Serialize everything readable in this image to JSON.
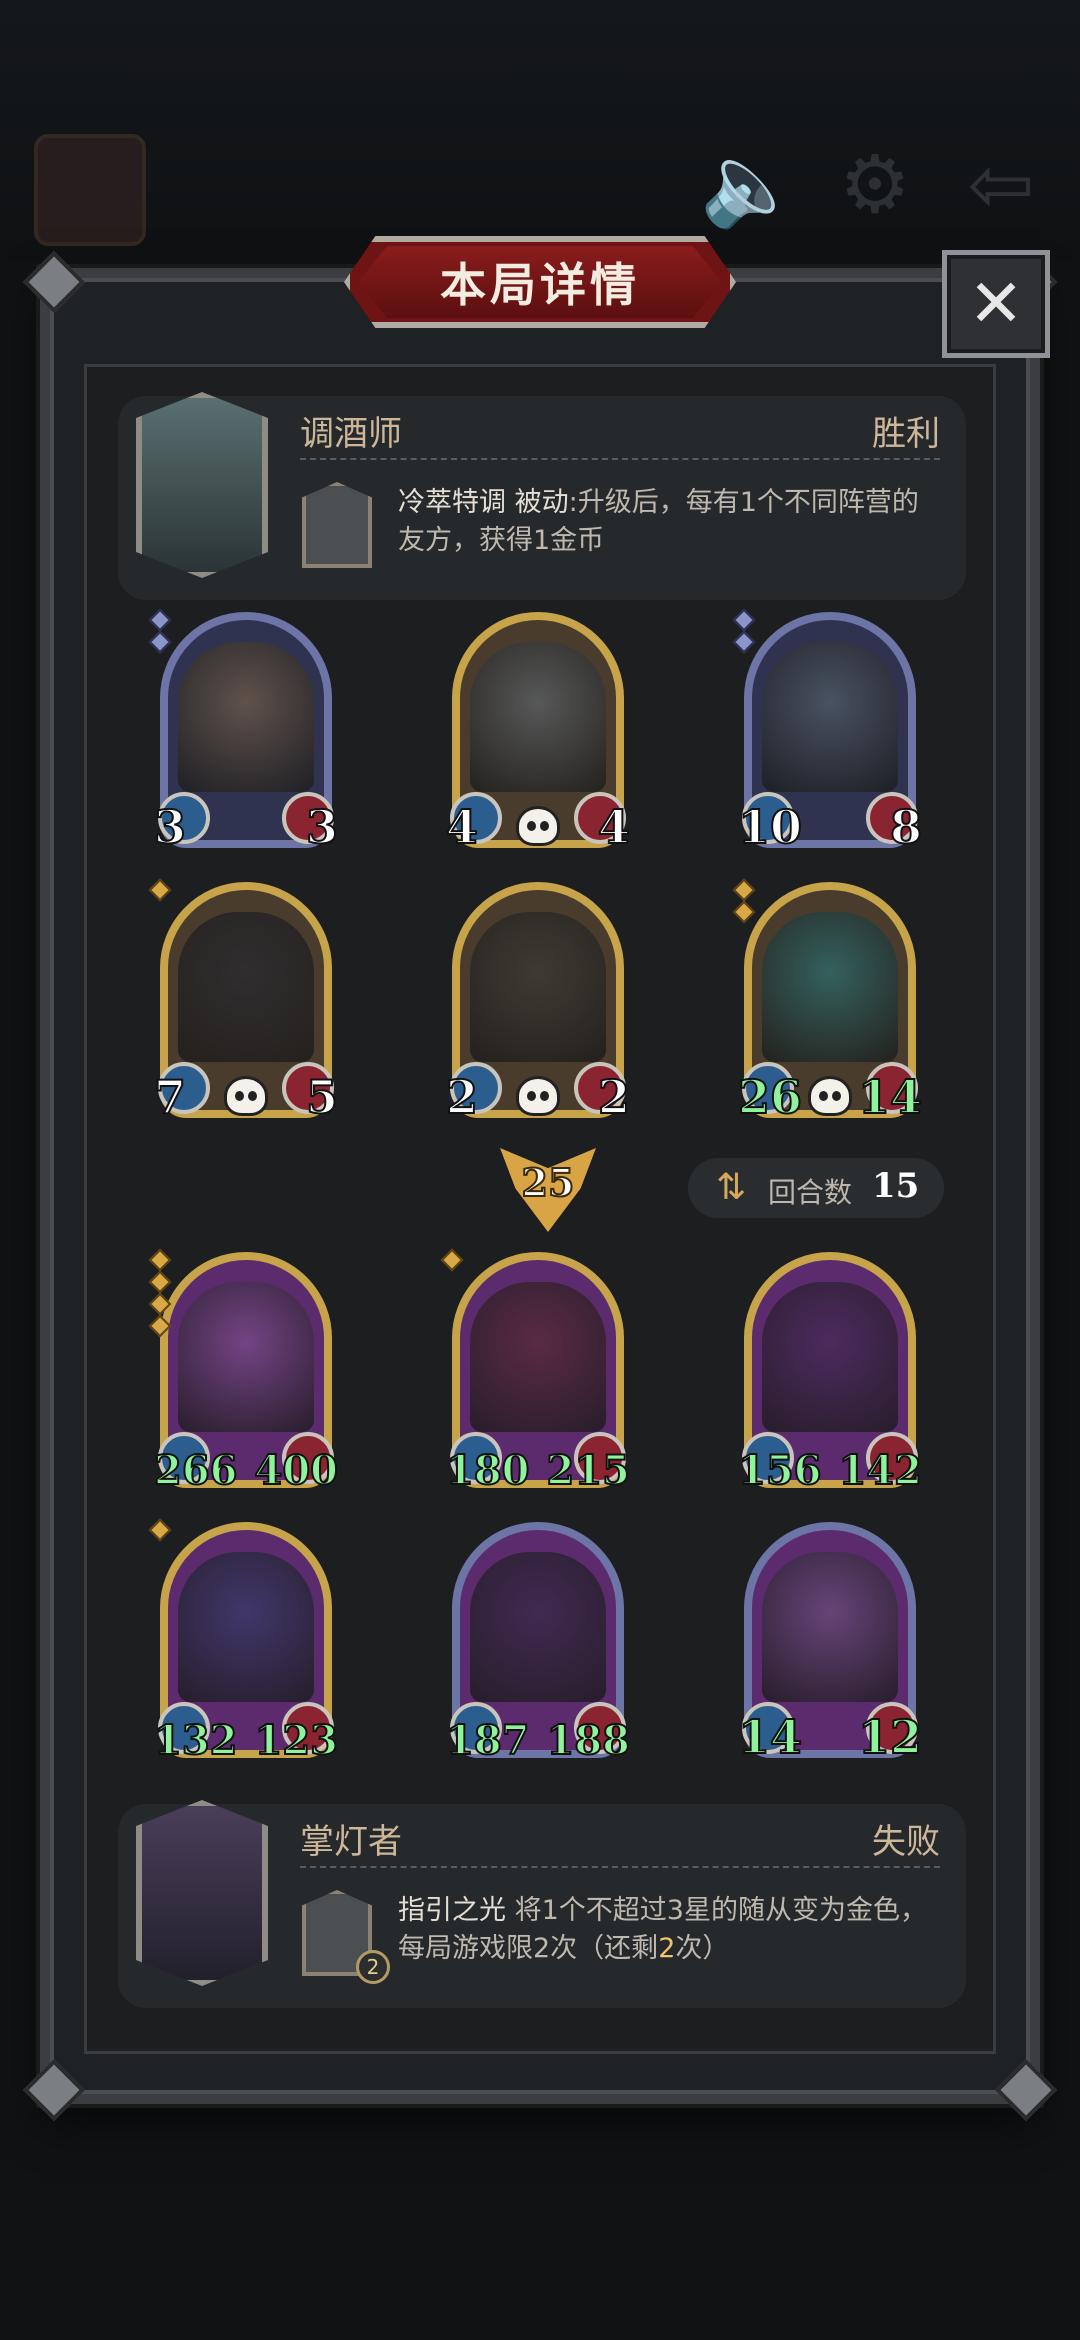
{
  "title": "本局详情",
  "close_label": "✕",
  "player_top": {
    "name": "调酒师",
    "result": "胜利",
    "skill_name": "冷萃特调",
    "skill_type": "被动",
    "skill_desc": ":升级后，每有1个不同阵营的友方，获得1金币"
  },
  "player_bottom": {
    "name": "掌灯者",
    "result": "失败",
    "skill_badge": "2",
    "skill_name": "指引之光",
    "skill_desc_a": "将1个不超过3星的随从变为金色，每局游戏限2次（还剩",
    "skill_desc_remaining": "2",
    "skill_desc_b": "次）"
  },
  "top_team": [
    {
      "atk": "3",
      "hp": "3",
      "stars": 2,
      "frame": "blue",
      "skull": false
    },
    {
      "atk": "4",
      "hp": "4",
      "stars": 0,
      "frame": "gold",
      "skull": true
    },
    {
      "atk": "10",
      "hp": "8",
      "stars": 2,
      "frame": "blue",
      "skull": false
    },
    {
      "atk": "7",
      "hp": "5",
      "stars": 1,
      "frame": "gold",
      "skull": true
    },
    {
      "atk": "2",
      "hp": "2",
      "stars": 0,
      "frame": "gold",
      "skull": true
    },
    {
      "atk": "26",
      "hp": "14",
      "stars": 2,
      "frame": "gold",
      "skull": true
    }
  ],
  "damage": "25",
  "round_label": "回合数",
  "round_value": "15",
  "bottom_team": [
    {
      "atk": "266",
      "hp": "400",
      "stars": 4,
      "frame": "gold-purple",
      "skull": false
    },
    {
      "atk": "180",
      "hp": "215",
      "stars": 1,
      "frame": "gold-purple",
      "skull": false
    },
    {
      "atk": "156",
      "hp": "142",
      "stars": 0,
      "frame": "gold-purple",
      "skull": false
    },
    {
      "atk": "132",
      "hp": "123",
      "stars": 1,
      "frame": "gold-purple",
      "skull": false
    },
    {
      "atk": "187",
      "hp": "188",
      "stars": 0,
      "frame": "blue-purple",
      "skull": false
    },
    {
      "atk": "14",
      "hp": "12",
      "stars": 0,
      "frame": "blue-purple",
      "skull": false
    }
  ],
  "colors": {
    "gold_frame": "#c7a449",
    "blue_frame": "#6d74a6",
    "stat_green": "#8ff39b",
    "banner_red": "#6e1414"
  }
}
